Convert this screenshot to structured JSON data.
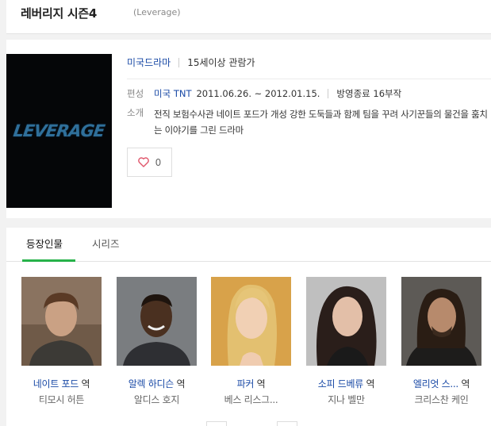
{
  "header": {
    "title": "레버리지 시즌4",
    "original_title": "(Leverage)"
  },
  "poster": {
    "logo_text": "LEVERAGE"
  },
  "meta": {
    "genre": "미국드라마",
    "rating": "15세이상 관람가",
    "broadcast_label": "편성",
    "broadcaster": "미국 TNT",
    "dates": "2011.06.26. ~ 2012.01.15.",
    "status": "방영종료 16부작",
    "summary_label": "소개",
    "summary": "전직 보험수사관 네이트 포드가 개성 강한 도둑들과 함께 팀을 꾸려 사기꾼들의 물건을 훔치는 이야기를 그린 드라마"
  },
  "like": {
    "count": "0",
    "icon": "heart-icon"
  },
  "tabs": [
    {
      "label": "등장인물"
    },
    {
      "label": "시리즈"
    }
  ],
  "cast": [
    {
      "role": "네이트 포드",
      "suffix": "역",
      "actor": "티모시 허튼"
    },
    {
      "role": "알렉 하디슨",
      "suffix": "역",
      "actor": "알디스 호지"
    },
    {
      "role": "파커",
      "suffix": "역",
      "actor": "베스 리스그..."
    },
    {
      "role": "소피 드베류",
      "suffix": "역",
      "actor": "지나 벨만"
    },
    {
      "role": "엘리엇 스...",
      "suffix": "역",
      "actor": "크리스찬 케인"
    }
  ],
  "colors": {
    "accent": "#27b24a",
    "link": "#1a4aa6",
    "heart": "#e0566b"
  }
}
